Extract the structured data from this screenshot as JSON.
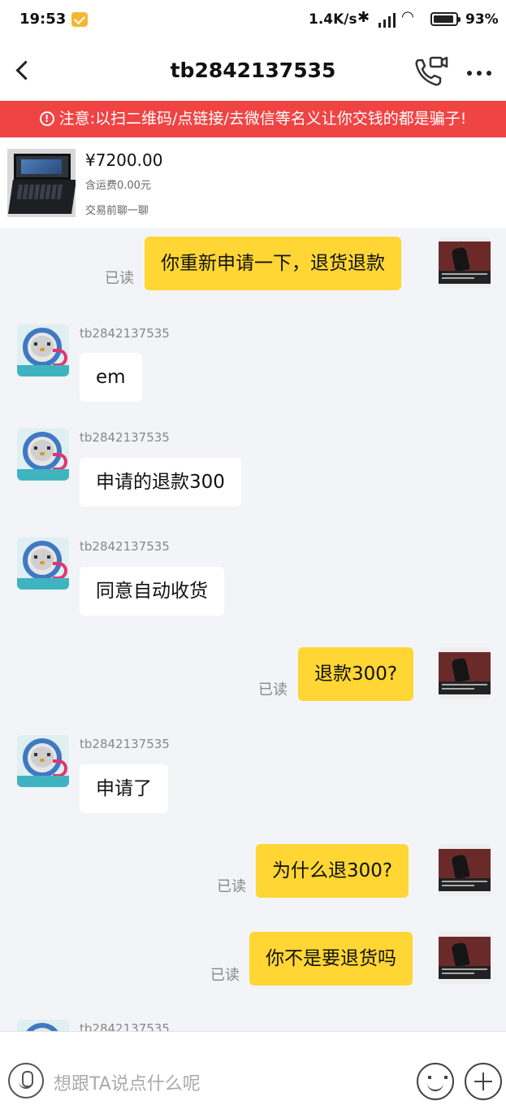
{
  "status_bar": {
    "time": "19:53",
    "network_speed": "1.4K/s",
    "battery": "93%"
  },
  "header": {
    "title": "tb2842137535"
  },
  "warning": {
    "text": "注意:以扫二维码/点链接/去微信等名义让你交钱的都是骗子!"
  },
  "product": {
    "price": "¥7200.00",
    "shipping": "含运费0.00元",
    "cta": "交易前聊一聊"
  },
  "messages": [
    {
      "side": "out",
      "text": "你重新申请一下，退货退款",
      "read": "已读"
    },
    {
      "side": "in",
      "sender": "tb2842137535",
      "text": "em"
    },
    {
      "side": "in",
      "sender": "tb2842137535",
      "text": "申请的退款300"
    },
    {
      "side": "in",
      "sender": "tb2842137535",
      "text": "同意自动收货"
    },
    {
      "side": "out",
      "text": "退款300?",
      "read": "已读"
    },
    {
      "side": "in",
      "sender": "tb2842137535",
      "text": "申请了"
    },
    {
      "side": "out",
      "text": "为什么退300?",
      "read": "已读"
    },
    {
      "side": "out",
      "text": "你不是要退货吗",
      "read": "已读"
    },
    {
      "side": "in",
      "sender": "tb2842137535",
      "text": ""
    }
  ],
  "input": {
    "placeholder": "想跟TA说点什么呢"
  }
}
